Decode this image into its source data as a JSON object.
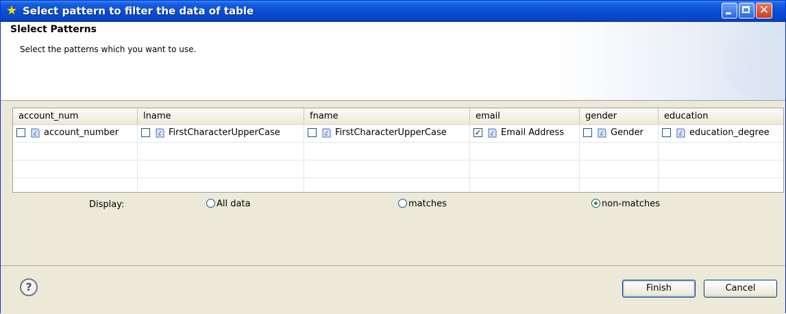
{
  "window": {
    "title": "Select pattern to filter the data of table"
  },
  "banner": {
    "title": "Slelect Patterns",
    "description": "Select the patterns which you want to use."
  },
  "table": {
    "columns": [
      "account_num",
      "lname",
      "fname",
      "email",
      "gender",
      "education"
    ],
    "patterns": [
      {
        "label": "account_number",
        "checked": false
      },
      {
        "label": "FirstCharacterUpperCase",
        "checked": false
      },
      {
        "label": "FirstCharacterUpperCase",
        "checked": false
      },
      {
        "label": "Email Address",
        "checked": true
      },
      {
        "label": "Gender",
        "checked": false
      },
      {
        "label": "education_degree",
        "checked": false
      }
    ]
  },
  "display": {
    "label": "Display:",
    "options": [
      {
        "label": "All data",
        "selected": false
      },
      {
        "label": "matches",
        "selected": false
      },
      {
        "label": "non-matches",
        "selected": true
      }
    ]
  },
  "footer": {
    "finish_label": "Finish",
    "cancel_label": "Cancel",
    "help_glyph": "?"
  },
  "colors": {
    "titlebar": "#0a4cd3",
    "accent_radio": "#21a121",
    "dialog_bg": "#ece9d8"
  },
  "icons": {
    "title": "star-icon",
    "pattern": "pattern-icon",
    "help": "help-icon"
  }
}
